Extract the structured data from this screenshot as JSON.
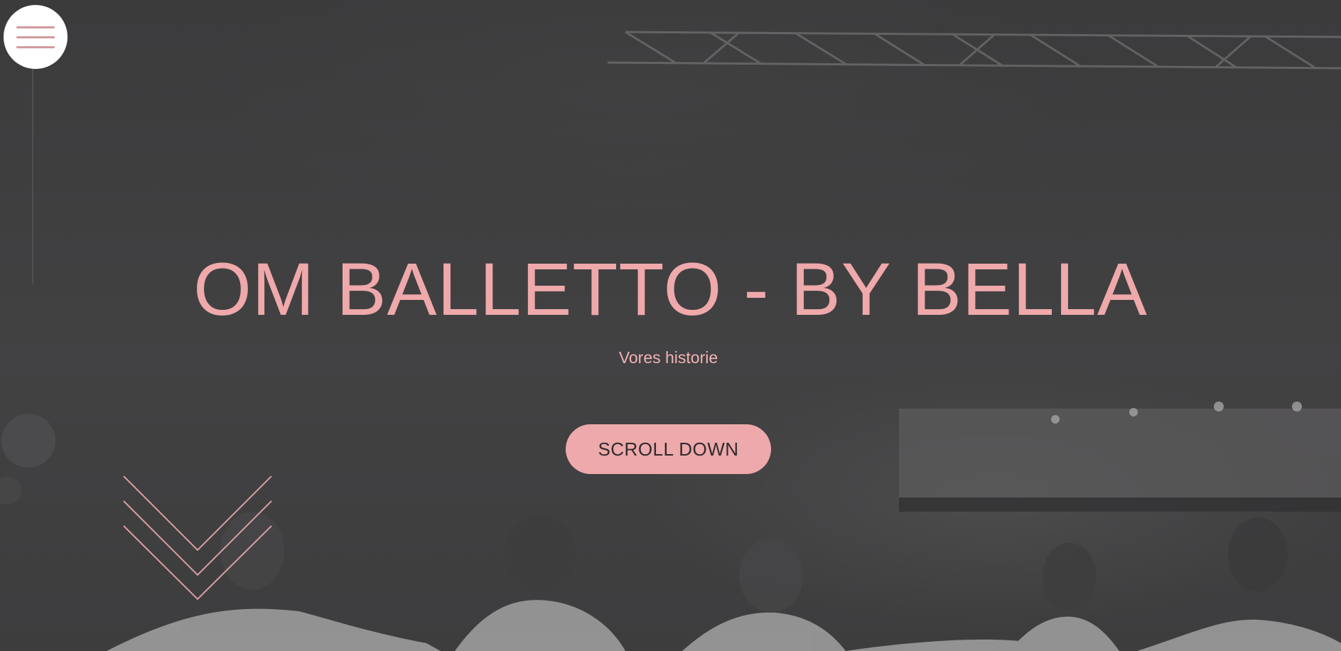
{
  "page": {
    "title": "OM BALLETTO - BY BELLA",
    "subtitle": "Vores historie"
  },
  "nav": {
    "menu_icon": "hamburger-menu-icon"
  },
  "cta": {
    "label": "SCROLL DOWN"
  },
  "decor": {
    "chevron_icon": "triple-chevron-down-icon",
    "background": "black-and-white photo of ballet dancers on a stage"
  },
  "colors": {
    "accent": "#eda9ab",
    "overlay": "#3f3e40",
    "menu_bg": "#ffffff"
  }
}
